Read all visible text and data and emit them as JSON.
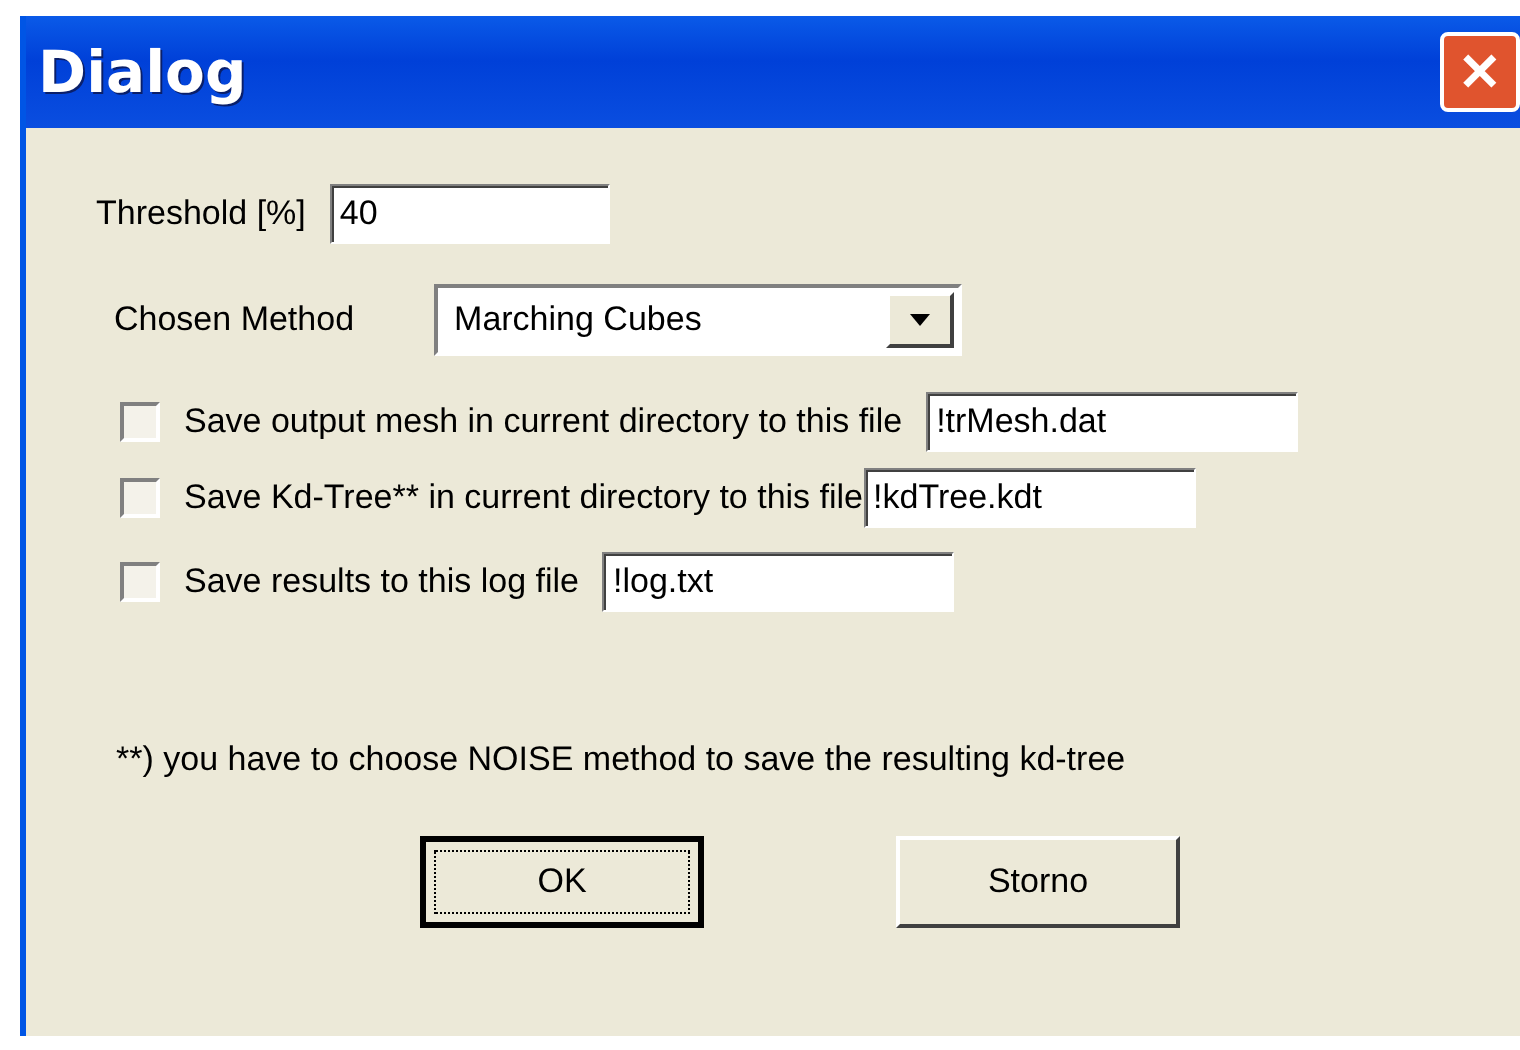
{
  "window": {
    "title": "Dialog",
    "close": "✕"
  },
  "threshold": {
    "label": "Threshold [%]",
    "value": "40"
  },
  "method": {
    "label": "Chosen Method",
    "value": "Marching Cubes"
  },
  "options": [
    {
      "label": "Save output mesh in current directory to this file",
      "checked": false,
      "value": "!trMesh.dat"
    },
    {
      "label": "Save Kd-Tree** in current directory to this file",
      "checked": false,
      "value": "!kdTree.kdt"
    },
    {
      "label": "Save results to this log file",
      "checked": false,
      "value": "!log.txt"
    }
  ],
  "note": "**) you have to choose NOISE method to save the resulting kd-tree",
  "buttons": [
    {
      "label": "OK",
      "default": true
    },
    {
      "label": "Storno",
      "default": false
    }
  ]
}
